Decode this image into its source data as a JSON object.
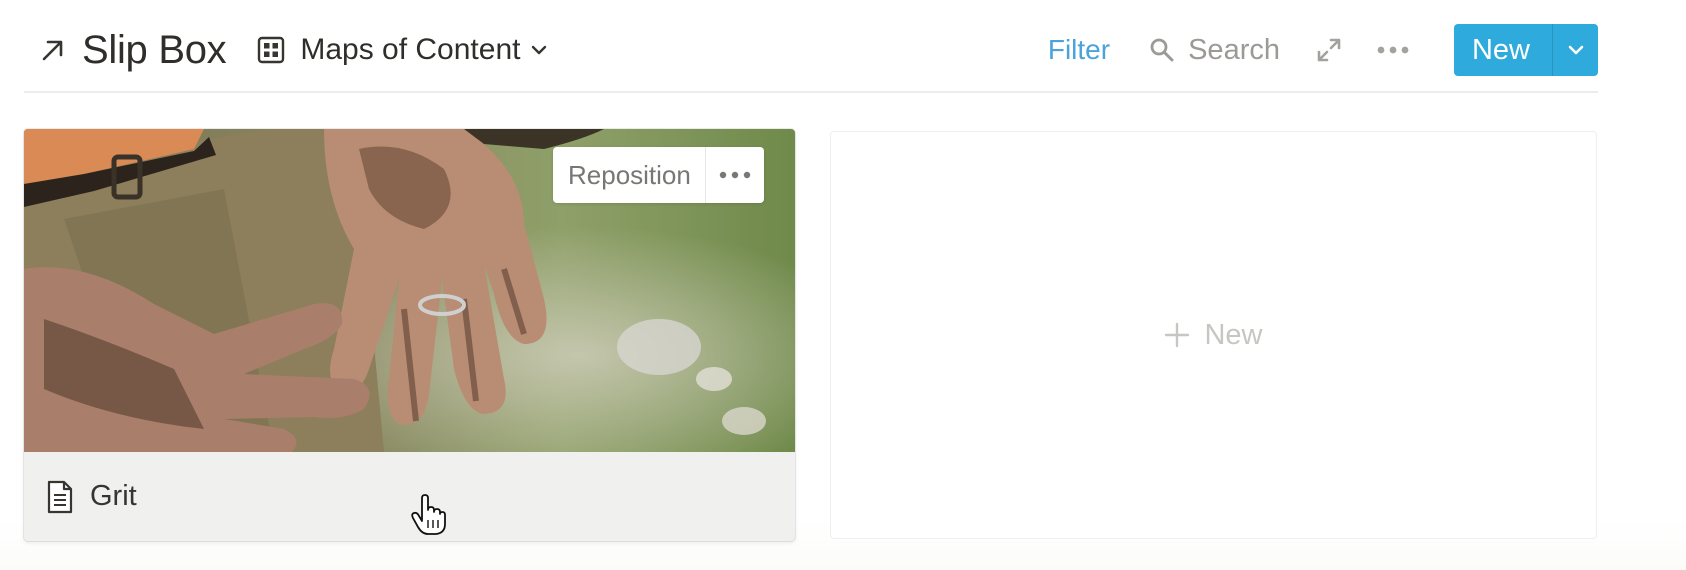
{
  "header": {
    "title": "Slip Box",
    "view_label": "Maps of Content",
    "filter_label": "Filter",
    "search_label": "Search",
    "new_label": "New"
  },
  "card": {
    "title": "Grit",
    "cover_action": "Reposition"
  },
  "new_card": {
    "label": "New"
  },
  "colors": {
    "accent": "#2eaadc",
    "filter": "#4ba3d9",
    "text": "#37352f",
    "muted": "#9b9a97"
  },
  "icons": [
    "link-arrow-icon",
    "gallery-view-icon",
    "chevron-down-icon",
    "search-icon",
    "expand-icon",
    "more-icon",
    "page-icon",
    "plus-icon",
    "hand-cursor-icon"
  ]
}
